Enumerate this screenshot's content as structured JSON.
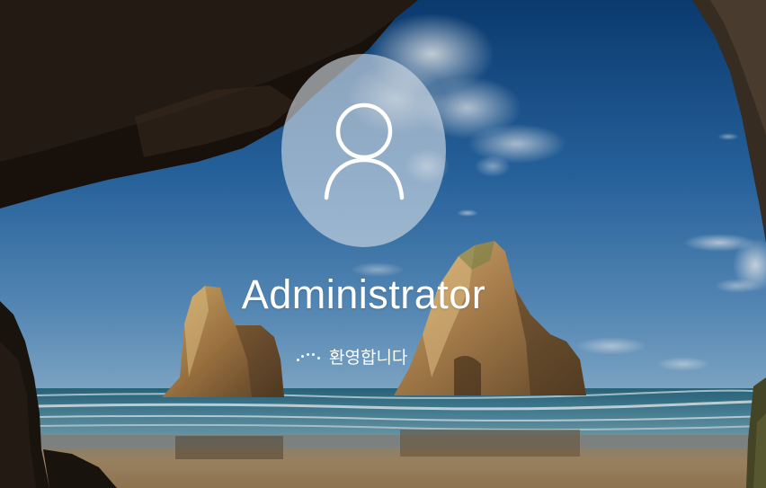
{
  "login": {
    "username": "Administrator",
    "status_text": "환영합니다"
  },
  "icons": {
    "avatar": "user-silhouette-icon",
    "spinner": "loading-spinner-icon"
  },
  "colors": {
    "sky": "#1a4f86",
    "avatar_circle": "#d6dee6",
    "text": "#ffffff",
    "sand": "#a88a62",
    "sea": "#2f6f86"
  }
}
